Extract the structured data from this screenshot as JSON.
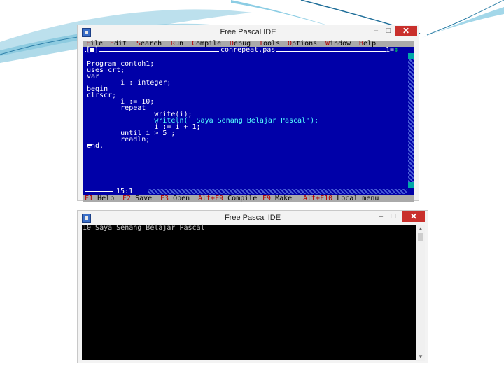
{
  "ide_window": {
    "title": "Free Pascal IDE",
    "minimize": "–",
    "maximize": "□",
    "close": "✕",
    "menu": [
      {
        "hotkey": "F",
        "rest": "ile"
      },
      {
        "hotkey": "E",
        "rest": "dit"
      },
      {
        "hotkey": "S",
        "rest": "earch"
      },
      {
        "hotkey": "R",
        "rest": "un"
      },
      {
        "hotkey": "C",
        "rest": "ompile"
      },
      {
        "hotkey": "D",
        "rest": "ebug"
      },
      {
        "hotkey": "T",
        "rest": "ools"
      },
      {
        "hotkey": "O",
        "rest": "ptions"
      },
      {
        "hotkey": "W",
        "rest": "indow"
      },
      {
        "hotkey": "H",
        "rest": "elp"
      }
    ],
    "editor": {
      "file_name": "conrepeat.pas",
      "close_box": "[■]",
      "window_number": "1",
      "arrow_box": "↕",
      "cursor_position": "15:1",
      "code_lines": [
        "Program contoh1;",
        "uses crt;",
        "var",
        "        i : integer;",
        "begin",
        "clrscr;",
        "        i := 10;",
        "        repeat",
        "                write(i);",
        "                writeln(' Saya Senang Belajar Pascal');",
        "                i := i + 1;",
        "        until i > 5 ;",
        "        readln;",
        "end."
      ]
    },
    "status_bar": [
      {
        "key": "F1",
        "label": "Help"
      },
      {
        "key": "F2",
        "label": "Save"
      },
      {
        "key": "F3",
        "label": "Open"
      },
      {
        "key": "Alt+F9",
        "label": "Compile"
      },
      {
        "key": "F9",
        "label": "Make"
      },
      {
        "key": "Alt+F10",
        "label": "Local menu"
      }
    ]
  },
  "console_window": {
    "title": "Free Pascal IDE",
    "minimize": "–",
    "maximize": "□",
    "close": "✕",
    "output": "10 Saya Senang Belajar Pascal"
  },
  "colors": {
    "dos_blue": "#0000a8",
    "menu_gray": "#aaaaaa",
    "hotkey_red": "#b00000",
    "close_red": "#c9302c"
  }
}
